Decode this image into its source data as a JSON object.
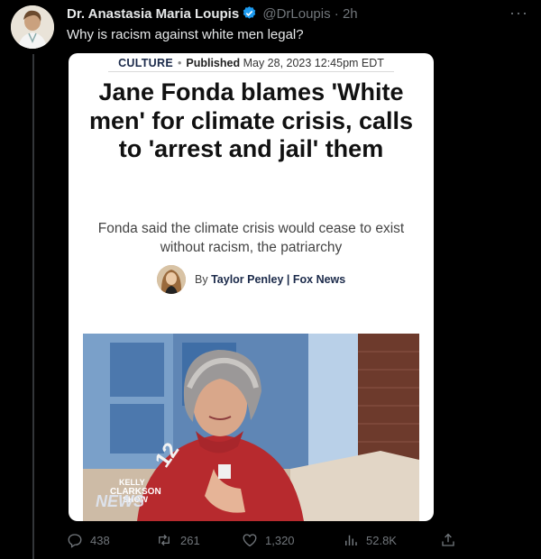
{
  "tweet": {
    "display_name": "Dr. Anastasia Maria Loupis",
    "handle": "@DrLoupis",
    "separator": "·",
    "time": "2h",
    "text": "Why is racism against white men legal?",
    "more_icon": "more-horizontal-icon",
    "verified_color": "#1d9bf0"
  },
  "article": {
    "category": "CULTURE",
    "separator": "•",
    "published_label": "Published",
    "published_date": "May 28, 2023 12:45pm EDT",
    "headline": "Jane Fonda blames 'White men' for climate crisis, calls to 'arrest and jail' them",
    "subheadline": "Fonda said the climate crisis would cease to exist without racism, the patriarchy",
    "byline_prefix": "By",
    "author": "Taylor Penley | Fox News",
    "photo_watermark": {
      "line1": "KELLY",
      "line2": "CLARKSON",
      "line3": "SHOW",
      "news": "NEWS"
    },
    "jersey_number": "12"
  },
  "actions": {
    "replies": "438",
    "retweets": "261",
    "likes": "1,320",
    "views": "52.8K"
  }
}
